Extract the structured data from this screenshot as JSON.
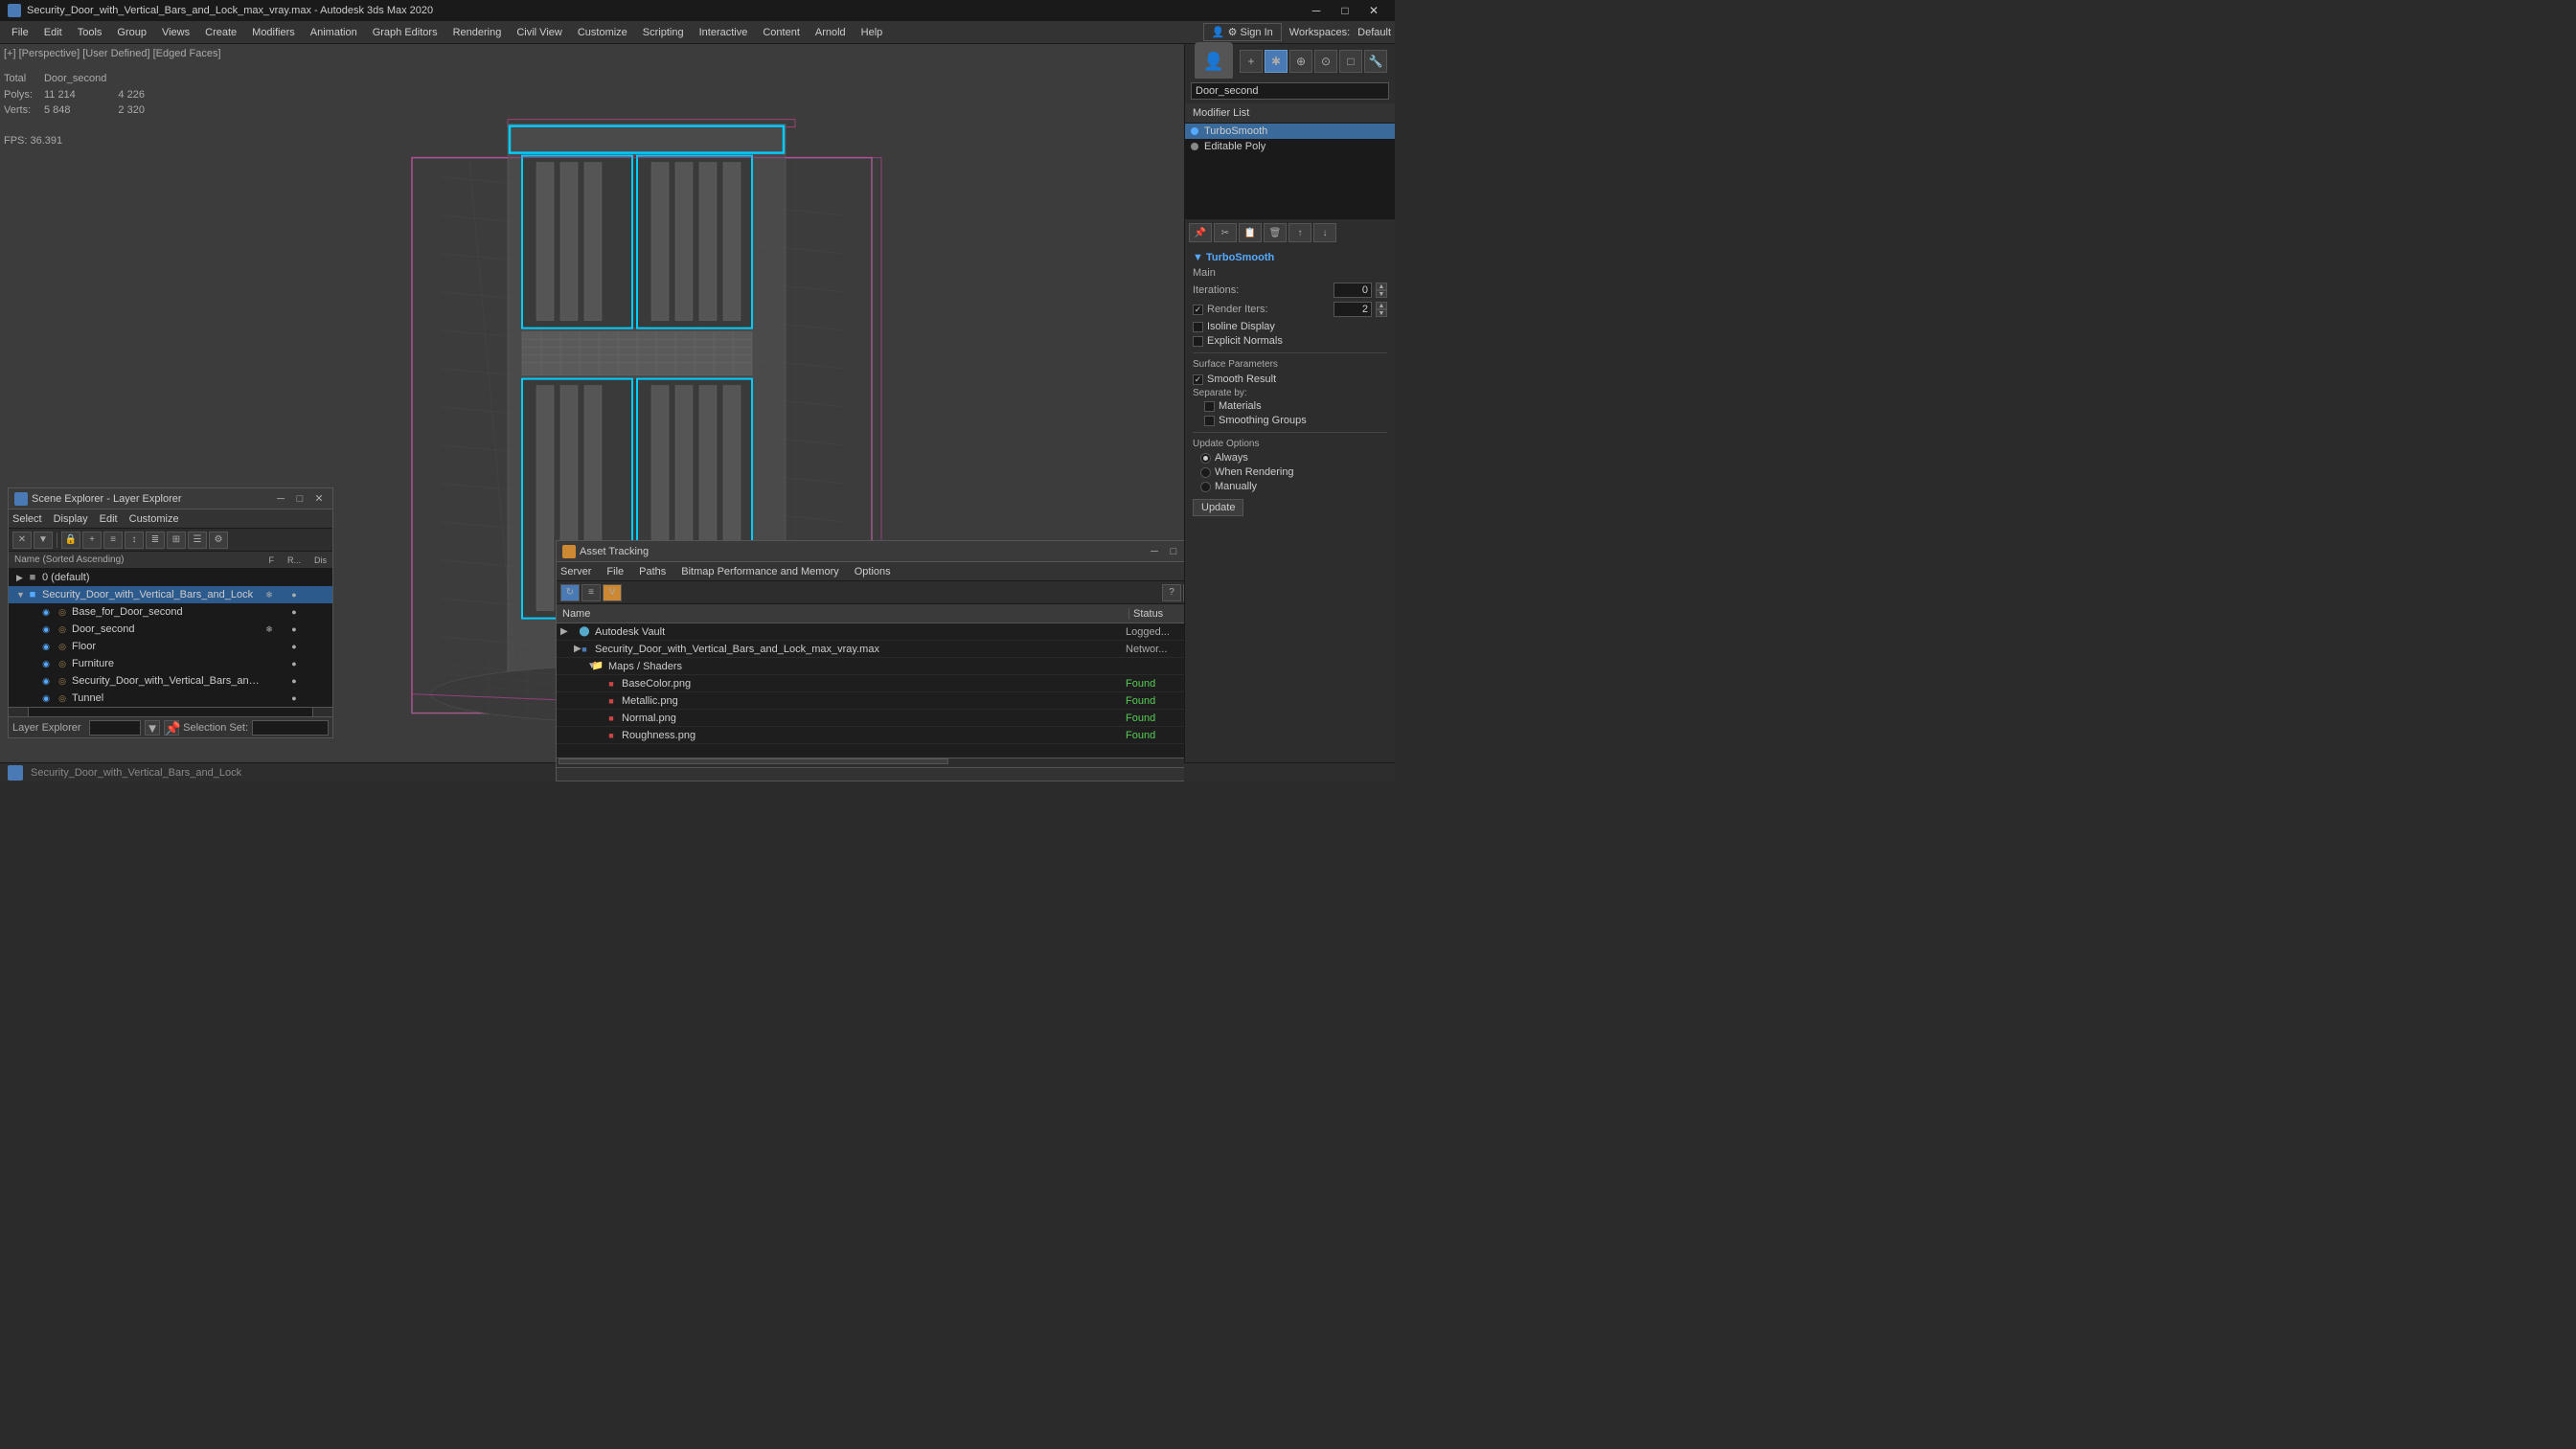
{
  "titlebar": {
    "title": "Security_Door_with_Vertical_Bars_and_Lock_max_vray.max - Autodesk 3ds Max 2020",
    "minimize": "─",
    "maximize": "□",
    "close": "✕"
  },
  "menubar": {
    "items": [
      "File",
      "Edit",
      "Tools",
      "Group",
      "Views",
      "Create",
      "Modifiers",
      "Animation",
      "Graph Editors",
      "Rendering",
      "Civil View",
      "Customize",
      "Scripting",
      "Interactive",
      "Content",
      "Arnold",
      "Help"
    ]
  },
  "signin": {
    "btn_label": "⚙ Sign In",
    "workspace_prefix": "Workspaces:",
    "workspace_name": "Default"
  },
  "viewport": {
    "header": "[+] [Perspective] [User Defined] [Edged Faces]",
    "stats": {
      "total_label": "Total",
      "total_value": "Door_second",
      "polys_label": "Polys:",
      "polys_total": "11 214",
      "polys_selected": "4 226",
      "verts_label": "Verts:",
      "verts_total": "5 848",
      "verts_selected": "2 320",
      "fps_label": "FPS:",
      "fps_value": "36.391"
    }
  },
  "right_panel": {
    "object_name": "Door_second",
    "modifier_list_label": "Modifier List",
    "modifiers": [
      {
        "name": "TurboSmooth",
        "color": "#55aaff",
        "selected": true
      },
      {
        "name": "Editable Poly",
        "color": "#888888",
        "selected": false
      }
    ],
    "turbosmooth": {
      "section_label": "TurboSmooth",
      "main_label": "Main",
      "iterations_label": "Iterations:",
      "iterations_value": "0",
      "render_iters_label": "Render Iters:",
      "render_iters_value": "2",
      "isoline_label": "Isoline Display",
      "explicit_label": "Explicit Normals",
      "surface_params_label": "Surface Parameters",
      "smooth_result_label": "Smooth Result",
      "separate_label": "Separate by:",
      "materials_label": "Materials",
      "smoothing_label": "Smoothing Groups",
      "update_options_label": "Update Options",
      "always_label": "Always",
      "when_rendering_label": "When Rendering",
      "manually_label": "Manually",
      "update_btn": "Update"
    }
  },
  "scene_explorer": {
    "title": "Scene Explorer - Layer Explorer",
    "menu_items": [
      "Select",
      "Display",
      "Edit",
      "Customize"
    ],
    "toolbar_buttons": [
      "✕",
      "▼",
      "🔒",
      "+",
      "≡",
      "↑↓",
      "≡≡",
      "⬛",
      "☰",
      "⚙"
    ],
    "columns": {
      "name_header": "Name (Sorted Ascending)",
      "f_header": "F",
      "r_header": "R...",
      "dis_header": "Dis"
    },
    "items": [
      {
        "indent": 0,
        "arrow": "",
        "name": "0 (default)",
        "depth": 0,
        "expanded": false
      },
      {
        "indent": 1,
        "arrow": "▶",
        "name": "Security_Door_with_Vertical_Bars_and_Lock",
        "depth": 1,
        "expanded": true,
        "selected": true
      },
      {
        "indent": 2,
        "arrow": "",
        "name": "Base_for_Door_second",
        "depth": 2
      },
      {
        "indent": 2,
        "arrow": "",
        "name": "Door_second",
        "depth": 2
      },
      {
        "indent": 2,
        "arrow": "",
        "name": "Floor",
        "depth": 2
      },
      {
        "indent": 2,
        "arrow": "",
        "name": "Furniture",
        "depth": 2
      },
      {
        "indent": 2,
        "arrow": "",
        "name": "Security_Door_with_Vertical_Bars_and_Lock",
        "depth": 2
      },
      {
        "indent": 2,
        "arrow": "",
        "name": "Tunnel",
        "depth": 2
      }
    ],
    "status_label": "Layer Explorer",
    "selection_label": "Selection Set:"
  },
  "asset_tracking": {
    "title": "Asset Tracking",
    "menu_items": [
      "Server",
      "File",
      "Paths",
      "Bitmap Performance and Memory",
      "Options"
    ],
    "columns": {
      "name": "Name",
      "status": "Status"
    },
    "items": [
      {
        "indent": 0,
        "expand": "▶",
        "name": "Autodesk Vault",
        "status": "Logged...",
        "is_folder": true,
        "icon_color": "#4a7ab5"
      },
      {
        "indent": 1,
        "expand": "▶",
        "name": "Security_Door_with_Vertical_Bars_and_Lock_max_vray.max",
        "status": "Networ...",
        "is_folder": false,
        "icon_color": "#4a7ab5"
      },
      {
        "indent": 2,
        "expand": "▼",
        "name": "Maps / Shaders",
        "status": "",
        "is_folder": true,
        "icon_color": "#888"
      },
      {
        "indent": 3,
        "expand": "",
        "name": "BaseColor.png",
        "status": "Found",
        "is_folder": false,
        "icon_color": "#cc4444"
      },
      {
        "indent": 3,
        "expand": "",
        "name": "Metallic.png",
        "status": "Found",
        "is_folder": false,
        "icon_color": "#cc4444"
      },
      {
        "indent": 3,
        "expand": "",
        "name": "Normal.png",
        "status": "Found",
        "is_folder": false,
        "icon_color": "#cc4444"
      },
      {
        "indent": 3,
        "expand": "",
        "name": "Roughness.png",
        "status": "Found",
        "is_folder": false,
        "icon_color": "#cc4444"
      }
    ]
  },
  "status_bar": {}
}
